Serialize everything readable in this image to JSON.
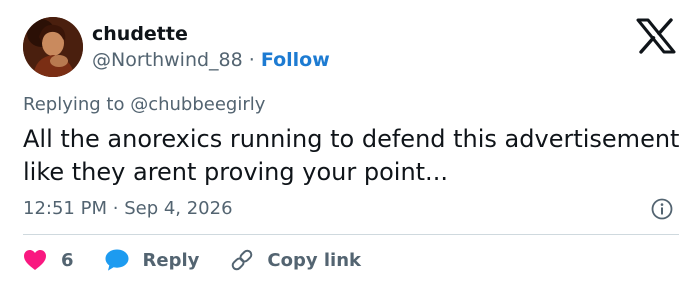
{
  "author": {
    "display_name": "chudette",
    "handle": "@Northwind_88",
    "separator": "·",
    "follow_label": "Follow"
  },
  "reply_context": {
    "prefix": "Replying to",
    "mention": "@chubbeegirly"
  },
  "tweet": {
    "text": "All the anorexics running to defend this advertisement like they arent proving your point...",
    "time": "12:51 PM",
    "separator": "·",
    "date": "Sep 4, 2026"
  },
  "actions": {
    "like_count": "6",
    "reply_label": "Reply",
    "copy_label": "Copy link"
  },
  "icons": {
    "logo": "x-logo-icon",
    "info": "info-icon",
    "like": "heart-icon",
    "reply": "speech-bubble-icon",
    "copy": "link-icon"
  },
  "colors": {
    "text": "#0f1419",
    "muted": "#536471",
    "accent": "#1d7bd2",
    "heart": "#f91880",
    "reply_bubble": "#1d9bf0",
    "divider": "#cfd9de"
  }
}
